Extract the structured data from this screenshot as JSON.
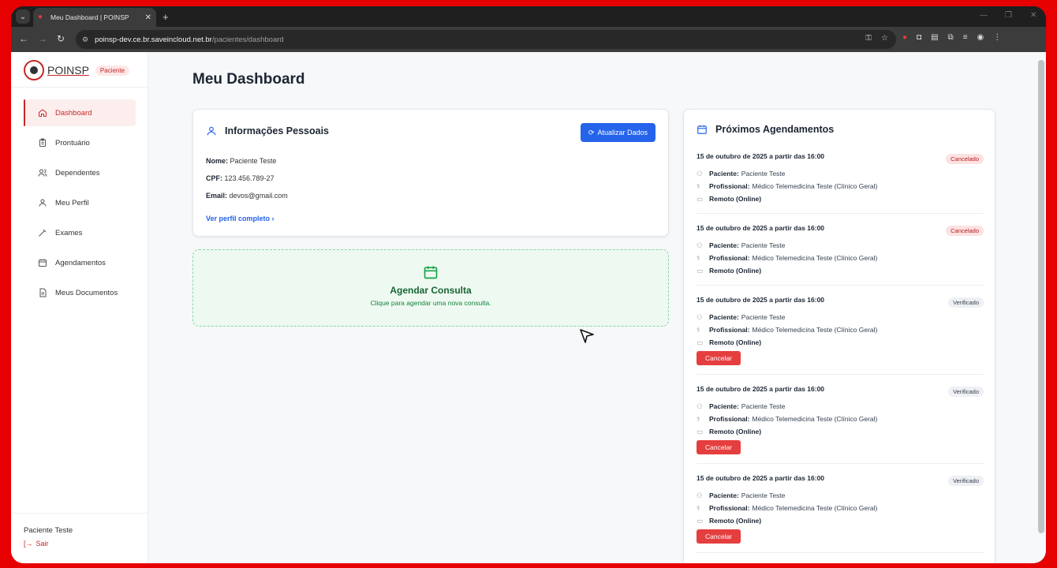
{
  "browser": {
    "tab_title": "Meu Dashboard | POINSP",
    "url_host": "poinsp-dev.ce.br.saveincloud.net.br",
    "url_path": "/pacientes/dashboard"
  },
  "brand": {
    "name": "POINSP",
    "role": "Paciente"
  },
  "sidebar": {
    "items": [
      {
        "label": "Dashboard",
        "icon": "home-icon"
      },
      {
        "label": "Prontuário",
        "icon": "clipboard-icon"
      },
      {
        "label": "Dependentes",
        "icon": "users-icon"
      },
      {
        "label": "Meu Perfil",
        "icon": "user-icon"
      },
      {
        "label": "Exames",
        "icon": "pipette-icon"
      },
      {
        "label": "Agendamentos",
        "icon": "calendar-icon"
      },
      {
        "label": "Meus Documentos",
        "icon": "document-icon"
      }
    ],
    "footer_user": "Paciente Teste",
    "logout_label": "Sair"
  },
  "main": {
    "title": "Meu Dashboard",
    "info": {
      "title": "Informações Pessoais",
      "refresh_label": "Atualizar Dados",
      "name_label": "Nome:",
      "name_value": "Paciente Teste",
      "cpf_label": "CPF:",
      "cpf_value": "123.456.789-27",
      "email_label": "Email:",
      "email_value": "devos@gmail.com",
      "profile_link": "Ver perfil completo"
    },
    "cta": {
      "title": "Agendar Consulta",
      "subtitle": "Clique para agendar uma nova consulta."
    },
    "appointments": {
      "title": "Próximos Agendamentos",
      "patient_label": "Paciente:",
      "professional_label": "Profissional:",
      "cancel_label": "Cancelar",
      "items": [
        {
          "date": "15 de outubro de 2025 a partir das 16:00",
          "status": "Cancelado",
          "patient": "Paciente Teste",
          "professional": "Médico Telemedicina Teste (Clínico Geral)",
          "mode": "Remoto (Online)"
        },
        {
          "date": "15 de outubro de 2025 a partir das 16:00",
          "status": "Cancelado",
          "patient": "Paciente Teste",
          "professional": "Médico Telemedicina Teste (Clínico Geral)",
          "mode": "Remoto (Online)"
        },
        {
          "date": "15 de outubro de 2025 a partir das 16:00",
          "status": "Verificado",
          "patient": "Paciente Teste",
          "professional": "Médico Telemedicina Teste (Clínico Geral)",
          "mode": "Remoto (Online)"
        },
        {
          "date": "15 de outubro de 2025 a partir das 16:00",
          "status": "Verificado",
          "patient": "Paciente Teste",
          "professional": "Médico Telemedicina Teste (Clínico Geral)",
          "mode": "Remoto (Online)"
        },
        {
          "date": "15 de outubro de 2025 a partir das 16:00",
          "status": "Verificado",
          "patient": "Paciente Teste",
          "professional": "Médico Telemedicina Teste (Clínico Geral)",
          "mode": "Remoto (Online)"
        }
      ]
    }
  }
}
